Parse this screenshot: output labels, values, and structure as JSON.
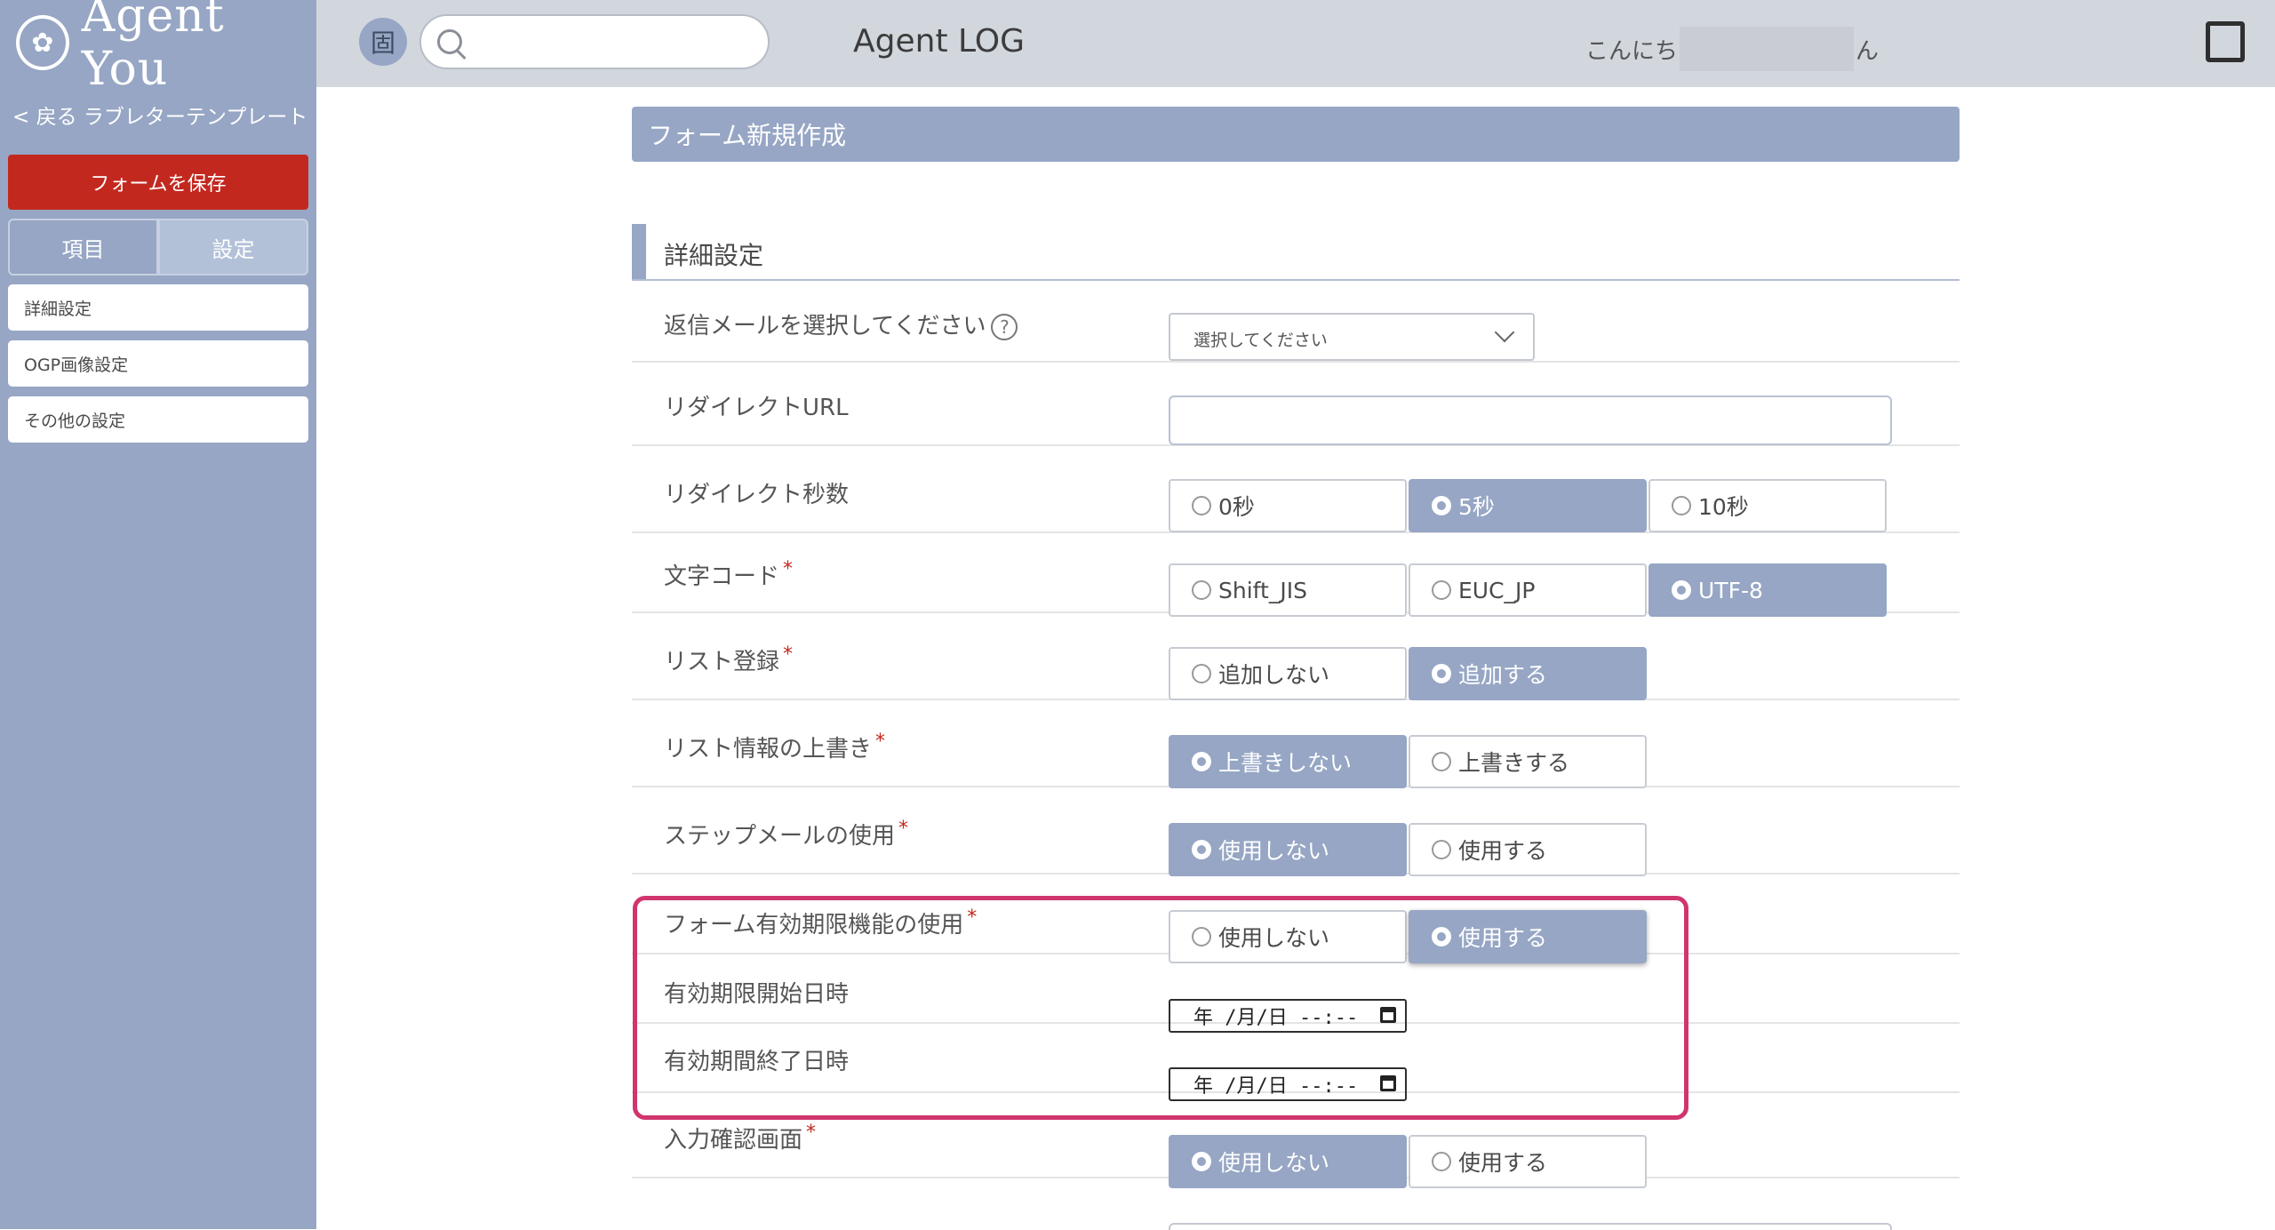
{
  "brand": {
    "logo_text": "Agent You",
    "logo_mark": "✿"
  },
  "header": {
    "app_title": "Agent LOG",
    "search_placeholder": "",
    "greeting_prefix": "こんにち",
    "greeting_suffix": "ん",
    "shortcut_icon": "固"
  },
  "sidebar": {
    "back_link": "< 戻る ラブレターテンプレート",
    "save_button": "フォームを保存",
    "tabs": {
      "items": "項目",
      "settings": "設定"
    },
    "nav": [
      "詳細設定",
      "OGP画像設定",
      "その他の設定"
    ]
  },
  "main": {
    "form_title": "フォーム新規作成",
    "section_title": "詳細設定",
    "rows": {
      "reply_mail": {
        "label": "返信メールを選択してください",
        "help": "?",
        "select_value": "選択してください"
      },
      "redirect_url": {
        "label": "リダイレクトURL",
        "value": ""
      },
      "redirect_seconds": {
        "label": "リダイレクト秒数",
        "options": [
          "0秒",
          "5秒",
          "10秒"
        ],
        "selected": "5秒"
      },
      "charset": {
        "label": "文字コード",
        "required": "*",
        "options": [
          "Shift_JIS",
          "EUC_JP",
          "UTF-8"
        ],
        "selected": "UTF-8"
      },
      "list_register": {
        "label": "リスト登録",
        "required": "*",
        "options": [
          "追加しない",
          "追加する"
        ],
        "selected": "追加する"
      },
      "list_overwrite": {
        "label": "リスト情報の上書き",
        "required": "*",
        "options": [
          "上書きしない",
          "上書きする"
        ],
        "selected": "上書きしない"
      },
      "step_mail": {
        "label": "ステップメールの使用",
        "required": "*",
        "options": [
          "使用しない",
          "使用する"
        ],
        "selected": "使用しない"
      },
      "expiry": {
        "label": "フォーム有効期限機能の使用",
        "required": "*",
        "options": [
          "使用しない",
          "使用する"
        ],
        "selected": "使用する"
      },
      "expiry_start": {
        "label": "有効期限開始日時",
        "value": "年 /月/日  --:--"
      },
      "expiry_end": {
        "label": "有効期間終了日時",
        "value": "年 /月/日  --:--"
      },
      "confirm_screen": {
        "label": "入力確認画面",
        "required": "*",
        "options": [
          "使用しない",
          "使用する"
        ],
        "selected": "使用しない"
      }
    }
  },
  "colors": {
    "accent": "#96a6c4",
    "save": "#c3281f",
    "highlight": "#d0356e",
    "header_bg": "#d2d7de"
  }
}
